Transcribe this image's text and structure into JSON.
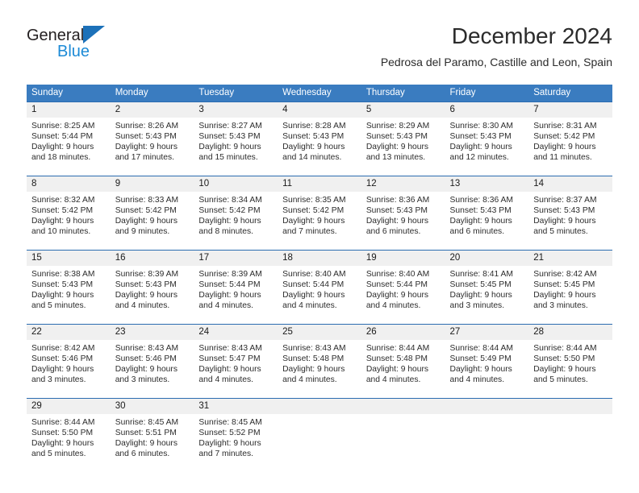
{
  "brand": {
    "line1": "General",
    "line2": "Blue",
    "triangle_color": "#1c71b9"
  },
  "header": {
    "title": "December 2024",
    "subtitle": "Pedrosa del Paramo, Castille and Leon, Spain"
  },
  "colors": {
    "header_blue": "#3a7cc0",
    "row_border_blue": "#2b6cb0",
    "daynum_band": "#f0f0f0",
    "brand_blue": "#1c8ad6"
  },
  "weekdays": [
    "Sunday",
    "Monday",
    "Tuesday",
    "Wednesday",
    "Thursday",
    "Friday",
    "Saturday"
  ],
  "weeks": [
    [
      {
        "day": "1",
        "sunrise": "Sunrise: 8:25 AM",
        "sunset": "Sunset: 5:44 PM",
        "daylight1": "Daylight: 9 hours",
        "daylight2": "and 18 minutes."
      },
      {
        "day": "2",
        "sunrise": "Sunrise: 8:26 AM",
        "sunset": "Sunset: 5:43 PM",
        "daylight1": "Daylight: 9 hours",
        "daylight2": "and 17 minutes."
      },
      {
        "day": "3",
        "sunrise": "Sunrise: 8:27 AM",
        "sunset": "Sunset: 5:43 PM",
        "daylight1": "Daylight: 9 hours",
        "daylight2": "and 15 minutes."
      },
      {
        "day": "4",
        "sunrise": "Sunrise: 8:28 AM",
        "sunset": "Sunset: 5:43 PM",
        "daylight1": "Daylight: 9 hours",
        "daylight2": "and 14 minutes."
      },
      {
        "day": "5",
        "sunrise": "Sunrise: 8:29 AM",
        "sunset": "Sunset: 5:43 PM",
        "daylight1": "Daylight: 9 hours",
        "daylight2": "and 13 minutes."
      },
      {
        "day": "6",
        "sunrise": "Sunrise: 8:30 AM",
        "sunset": "Sunset: 5:43 PM",
        "daylight1": "Daylight: 9 hours",
        "daylight2": "and 12 minutes."
      },
      {
        "day": "7",
        "sunrise": "Sunrise: 8:31 AM",
        "sunset": "Sunset: 5:42 PM",
        "daylight1": "Daylight: 9 hours",
        "daylight2": "and 11 minutes."
      }
    ],
    [
      {
        "day": "8",
        "sunrise": "Sunrise: 8:32 AM",
        "sunset": "Sunset: 5:42 PM",
        "daylight1": "Daylight: 9 hours",
        "daylight2": "and 10 minutes."
      },
      {
        "day": "9",
        "sunrise": "Sunrise: 8:33 AM",
        "sunset": "Sunset: 5:42 PM",
        "daylight1": "Daylight: 9 hours",
        "daylight2": "and 9 minutes."
      },
      {
        "day": "10",
        "sunrise": "Sunrise: 8:34 AM",
        "sunset": "Sunset: 5:42 PM",
        "daylight1": "Daylight: 9 hours",
        "daylight2": "and 8 minutes."
      },
      {
        "day": "11",
        "sunrise": "Sunrise: 8:35 AM",
        "sunset": "Sunset: 5:42 PM",
        "daylight1": "Daylight: 9 hours",
        "daylight2": "and 7 minutes."
      },
      {
        "day": "12",
        "sunrise": "Sunrise: 8:36 AM",
        "sunset": "Sunset: 5:43 PM",
        "daylight1": "Daylight: 9 hours",
        "daylight2": "and 6 minutes."
      },
      {
        "day": "13",
        "sunrise": "Sunrise: 8:36 AM",
        "sunset": "Sunset: 5:43 PM",
        "daylight1": "Daylight: 9 hours",
        "daylight2": "and 6 minutes."
      },
      {
        "day": "14",
        "sunrise": "Sunrise: 8:37 AM",
        "sunset": "Sunset: 5:43 PM",
        "daylight1": "Daylight: 9 hours",
        "daylight2": "and 5 minutes."
      }
    ],
    [
      {
        "day": "15",
        "sunrise": "Sunrise: 8:38 AM",
        "sunset": "Sunset: 5:43 PM",
        "daylight1": "Daylight: 9 hours",
        "daylight2": "and 5 minutes."
      },
      {
        "day": "16",
        "sunrise": "Sunrise: 8:39 AM",
        "sunset": "Sunset: 5:43 PM",
        "daylight1": "Daylight: 9 hours",
        "daylight2": "and 4 minutes."
      },
      {
        "day": "17",
        "sunrise": "Sunrise: 8:39 AM",
        "sunset": "Sunset: 5:44 PM",
        "daylight1": "Daylight: 9 hours",
        "daylight2": "and 4 minutes."
      },
      {
        "day": "18",
        "sunrise": "Sunrise: 8:40 AM",
        "sunset": "Sunset: 5:44 PM",
        "daylight1": "Daylight: 9 hours",
        "daylight2": "and 4 minutes."
      },
      {
        "day": "19",
        "sunrise": "Sunrise: 8:40 AM",
        "sunset": "Sunset: 5:44 PM",
        "daylight1": "Daylight: 9 hours",
        "daylight2": "and 4 minutes."
      },
      {
        "day": "20",
        "sunrise": "Sunrise: 8:41 AM",
        "sunset": "Sunset: 5:45 PM",
        "daylight1": "Daylight: 9 hours",
        "daylight2": "and 3 minutes."
      },
      {
        "day": "21",
        "sunrise": "Sunrise: 8:42 AM",
        "sunset": "Sunset: 5:45 PM",
        "daylight1": "Daylight: 9 hours",
        "daylight2": "and 3 minutes."
      }
    ],
    [
      {
        "day": "22",
        "sunrise": "Sunrise: 8:42 AM",
        "sunset": "Sunset: 5:46 PM",
        "daylight1": "Daylight: 9 hours",
        "daylight2": "and 3 minutes."
      },
      {
        "day": "23",
        "sunrise": "Sunrise: 8:43 AM",
        "sunset": "Sunset: 5:46 PM",
        "daylight1": "Daylight: 9 hours",
        "daylight2": "and 3 minutes."
      },
      {
        "day": "24",
        "sunrise": "Sunrise: 8:43 AM",
        "sunset": "Sunset: 5:47 PM",
        "daylight1": "Daylight: 9 hours",
        "daylight2": "and 4 minutes."
      },
      {
        "day": "25",
        "sunrise": "Sunrise: 8:43 AM",
        "sunset": "Sunset: 5:48 PM",
        "daylight1": "Daylight: 9 hours",
        "daylight2": "and 4 minutes."
      },
      {
        "day": "26",
        "sunrise": "Sunrise: 8:44 AM",
        "sunset": "Sunset: 5:48 PM",
        "daylight1": "Daylight: 9 hours",
        "daylight2": "and 4 minutes."
      },
      {
        "day": "27",
        "sunrise": "Sunrise: 8:44 AM",
        "sunset": "Sunset: 5:49 PM",
        "daylight1": "Daylight: 9 hours",
        "daylight2": "and 4 minutes."
      },
      {
        "day": "28",
        "sunrise": "Sunrise: 8:44 AM",
        "sunset": "Sunset: 5:50 PM",
        "daylight1": "Daylight: 9 hours",
        "daylight2": "and 5 minutes."
      }
    ],
    [
      {
        "day": "29",
        "sunrise": "Sunrise: 8:44 AM",
        "sunset": "Sunset: 5:50 PM",
        "daylight1": "Daylight: 9 hours",
        "daylight2": "and 5 minutes."
      },
      {
        "day": "30",
        "sunrise": "Sunrise: 8:45 AM",
        "sunset": "Sunset: 5:51 PM",
        "daylight1": "Daylight: 9 hours",
        "daylight2": "and 6 minutes."
      },
      {
        "day": "31",
        "sunrise": "Sunrise: 8:45 AM",
        "sunset": "Sunset: 5:52 PM",
        "daylight1": "Daylight: 9 hours",
        "daylight2": "and 7 minutes."
      },
      {
        "day": "",
        "sunrise": "",
        "sunset": "",
        "daylight1": "",
        "daylight2": ""
      },
      {
        "day": "",
        "sunrise": "",
        "sunset": "",
        "daylight1": "",
        "daylight2": ""
      },
      {
        "day": "",
        "sunrise": "",
        "sunset": "",
        "daylight1": "",
        "daylight2": ""
      },
      {
        "day": "",
        "sunrise": "",
        "sunset": "",
        "daylight1": "",
        "daylight2": ""
      }
    ]
  ]
}
